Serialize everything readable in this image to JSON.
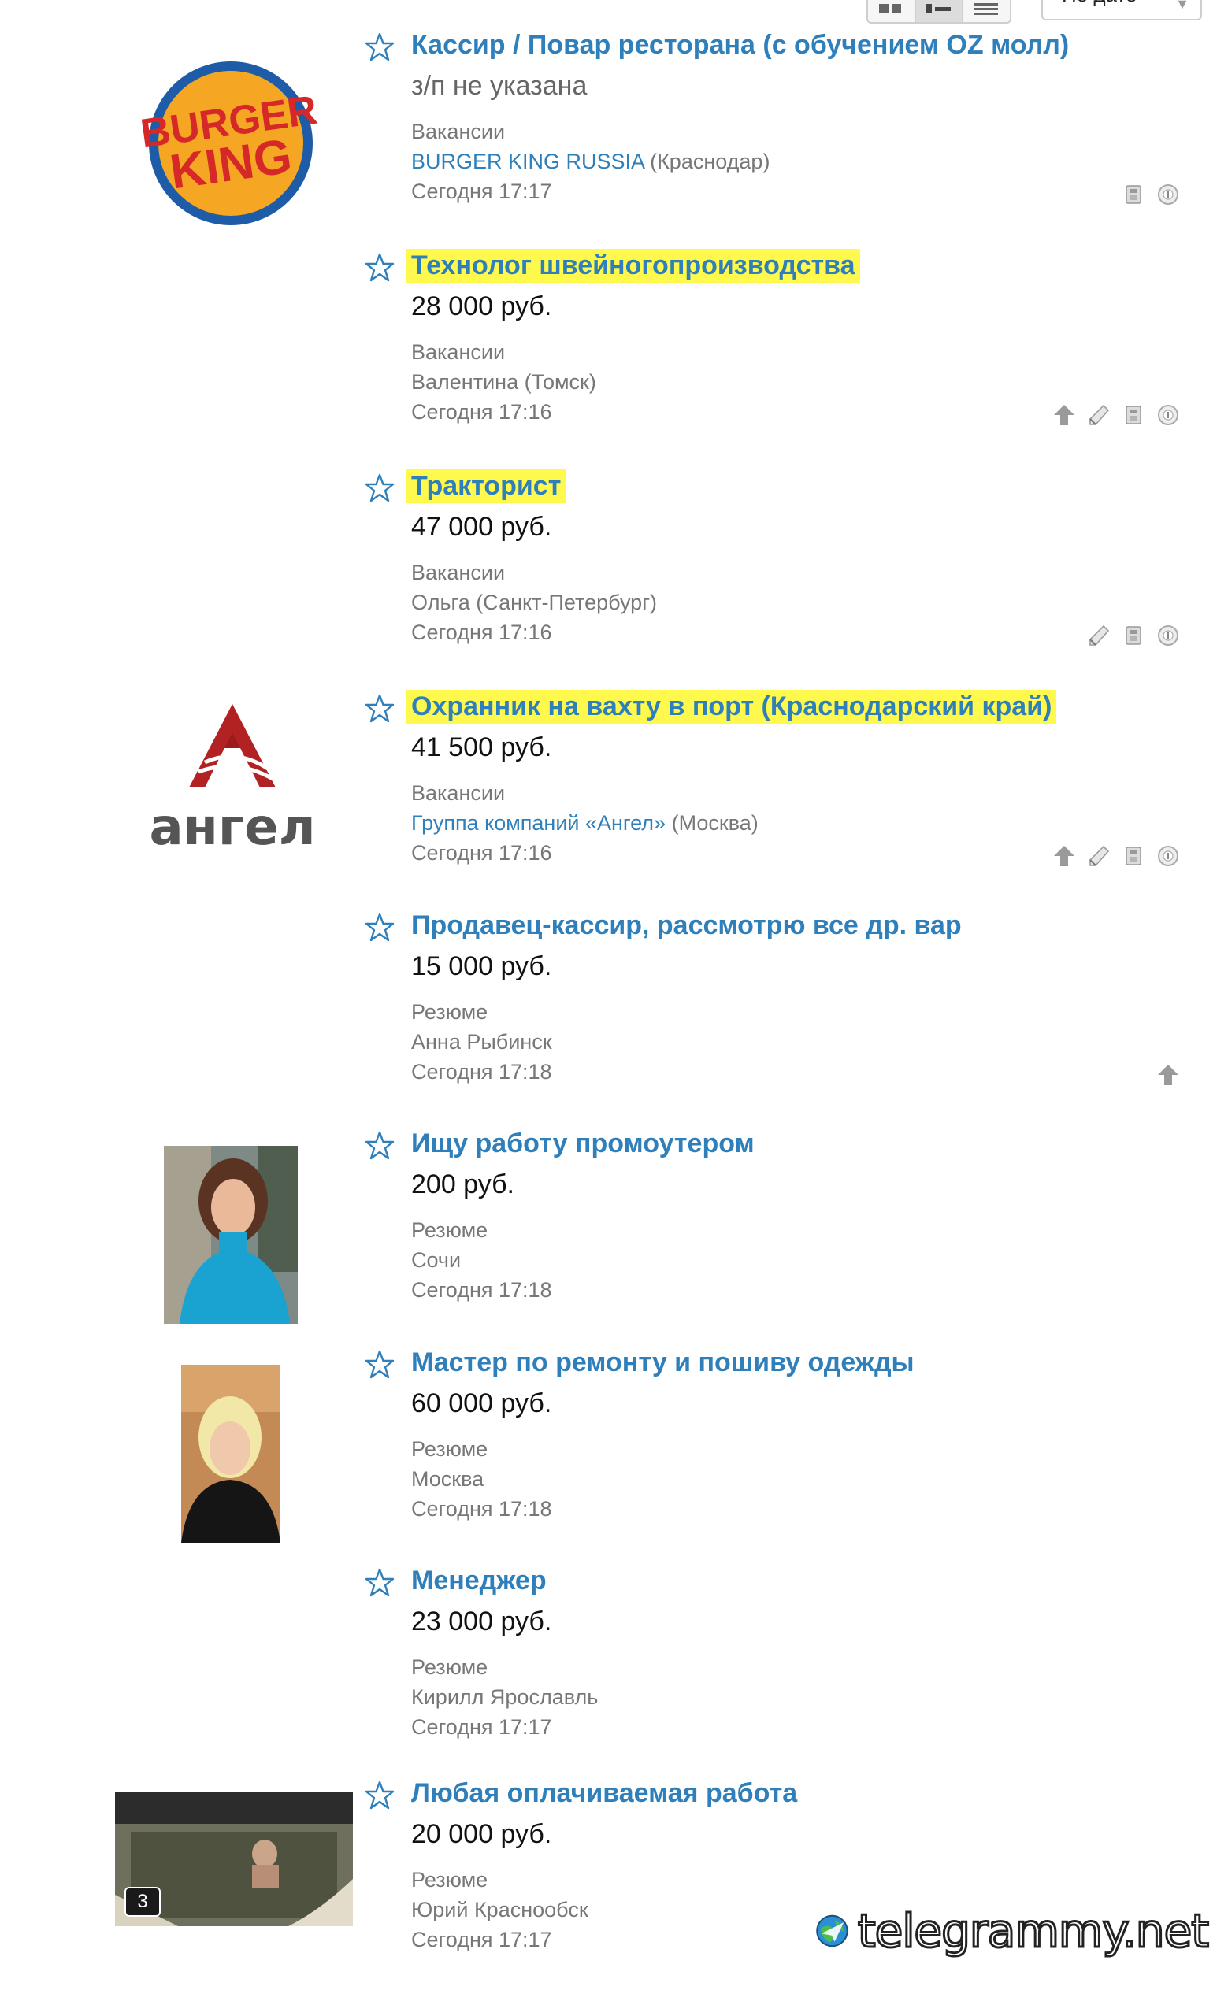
{
  "controls": {
    "view_options": [
      "grid-view-icon",
      "list-view-icon",
      "compact-view-icon"
    ],
    "sort_label": "По дате"
  },
  "listings": [
    {
      "title": "Кассир / Повар ресторана (с обучением OZ молл)",
      "price": "з/п не указана",
      "category": "Вакансии",
      "author_link": "BURGER KING RUSSIA",
      "author_suffix": " (Краснодар)",
      "date": "Сегодня 17:17",
      "highlighted": false,
      "thumb": "burger-king-logo",
      "actions": [
        "print-icon",
        "info-icon"
      ]
    },
    {
      "title": "Технолог швейногопроизводства",
      "price": "28 000 руб.",
      "category": "Вакансии",
      "author": "Валентина (Томск)",
      "date": "Сегодня 17:16",
      "highlighted": true,
      "actions": [
        "up-arrow-icon",
        "pen-icon",
        "print-icon",
        "info-icon"
      ]
    },
    {
      "title": "Тракторист",
      "price": "47 000 руб.",
      "category": "Вакансии",
      "author": "Ольга (Санкт-Петербург)",
      "date": "Сегодня 17:16",
      "highlighted": true,
      "actions": [
        "pen-icon",
        "print-icon",
        "info-icon"
      ]
    },
    {
      "title": "Охранник на вахту в порт (Краснодарский край)",
      "price": "41 500 руб.",
      "category": "Вакансии",
      "author_link": "Группа компаний «Ангел»",
      "author_suffix": " (Москва)",
      "date": "Сегодня 17:16",
      "highlighted": true,
      "thumb": "angel-logo",
      "thumb_text": "ангел",
      "actions": [
        "up-arrow-icon",
        "pen-icon",
        "print-icon",
        "info-icon"
      ]
    },
    {
      "title": "Продавец-кассир, рассмотрю все др. вар",
      "price": "15 000 руб.",
      "category": "Резюме",
      "author": "Анна Рыбинск",
      "date": "Сегодня 17:18",
      "highlighted": false,
      "actions": [
        "up-arrow-icon"
      ]
    },
    {
      "title": "Ищу работу промоутером",
      "price": "200 руб.",
      "category": "Резюме",
      "author": "Сочи",
      "date": "Сегодня 17:18",
      "highlighted": false,
      "thumb": "photo-woman-blue",
      "actions": []
    },
    {
      "title": "Мастер по ремонту и пошиву одежды",
      "price": "60 000 руб.",
      "category": "Резюме",
      "author": "Москва",
      "date": "Сегодня 17:18",
      "highlighted": false,
      "thumb": "photo-woman-blonde",
      "actions": []
    },
    {
      "title": "Менеджер",
      "price": "23 000 руб.",
      "category": "Резюме",
      "author": "Кирилл Ярославль",
      "date": "Сегодня 17:17",
      "highlighted": false,
      "actions": []
    },
    {
      "title": "Любая оплачиваемая работа",
      "price": "20 000 руб.",
      "category": "Резюме",
      "author": "Юрий Краснообск",
      "date": "Сегодня 17:17",
      "highlighted": false,
      "thumb": "photo-ice-swim",
      "photo_count": "3",
      "actions": []
    }
  ],
  "watermark": "telegrammy.net",
  "colors": {
    "link": "#2f7fba",
    "highlight": "#fff94d",
    "muted": "#777777"
  }
}
